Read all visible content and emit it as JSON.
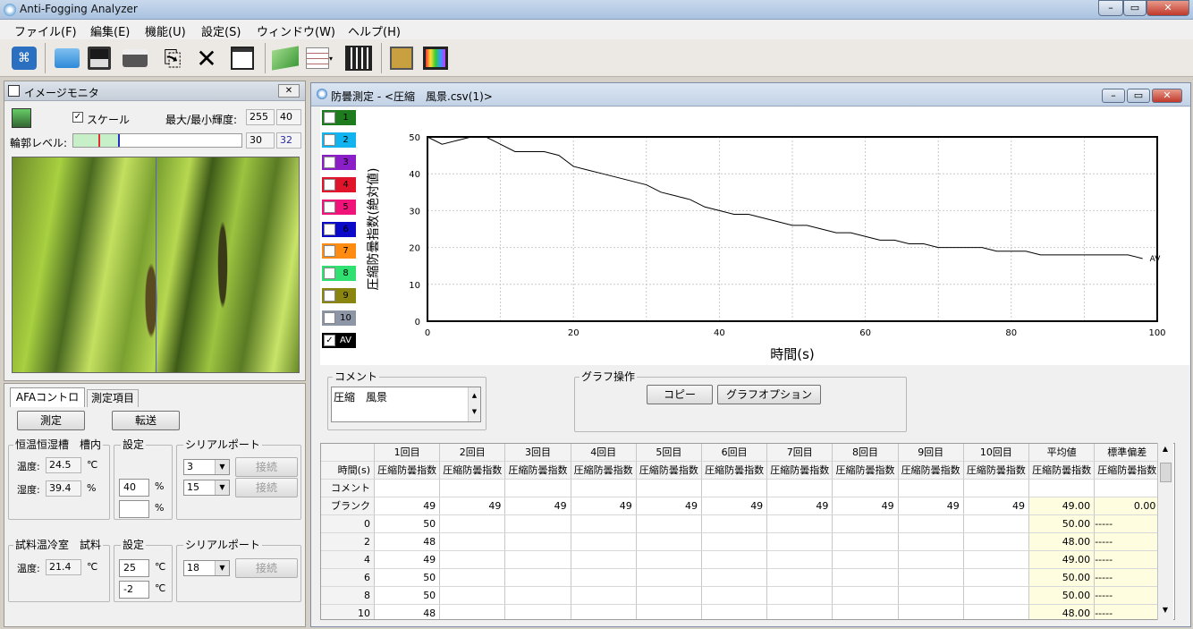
{
  "app": {
    "title": "Anti-Fogging Analyzer"
  },
  "menu": [
    "ファイル(F)",
    "編集(E)",
    "機能(U)",
    "設定(S)",
    "ウィンドウ(W)",
    "ヘルプ(H)"
  ],
  "toolbar": {
    "icons": [
      "monitor-icon",
      "open-folder-icon",
      "save-icon",
      "print-icon",
      "copy-icon",
      "delete-icon",
      "properties-icon",
      "graph-icon",
      "table-icon",
      "export-icon",
      "filter-icon",
      "display-icon"
    ]
  },
  "image_monitor": {
    "title": "イメージモニタ",
    "scale_label": "スケール",
    "scale_checked": true,
    "maxmin_label": "最大/最小輝度:",
    "max_value": "255",
    "min_value": "40",
    "contour_label": "輪郭レベル:",
    "contour_a": "30",
    "contour_b": "32"
  },
  "afa": {
    "tabs": [
      "AFAコントローラ",
      "測定項目"
    ],
    "measure_button": "測定",
    "transfer_button": "転送",
    "chamber": {
      "group_label": "恒温恒湿槽　槽内",
      "temp_label": "温度:",
      "temp_value": "24.5",
      "temp_unit": "℃",
      "hum_label": "湿度:",
      "hum_value": "39.4",
      "hum_unit": "%",
      "setting_label": "設定",
      "set_value1": "40",
      "set_unit1": "%",
      "set_value2": "",
      "set_unit2": "%",
      "serial_label": "シリアルポート",
      "port1": "3",
      "port2": "15",
      "connect1": "接続",
      "connect2": "接続"
    },
    "sample": {
      "group_label": "試料温冷室　試料",
      "temp_label": "温度:",
      "temp_value": "21.4",
      "temp_unit": "℃",
      "setting_label": "設定",
      "set_value1": "25",
      "set_unit1": "℃",
      "set_value2": "-2",
      "set_unit2": "℃",
      "serial_label": "シリアルポート",
      "port": "18",
      "connect": "接続"
    }
  },
  "measurement_window": {
    "title": "防曇測定 - <圧縮　風景.csv(1)>",
    "legend": [
      {
        "label": "1",
        "color": "#1e7b1e",
        "checked": false
      },
      {
        "label": "2",
        "color": "#12b4f0",
        "checked": false
      },
      {
        "label": "3",
        "color": "#8a1fc8",
        "checked": false
      },
      {
        "label": "4",
        "color": "#e0142a",
        "checked": false
      },
      {
        "label": "5",
        "color": "#f0147a",
        "checked": false
      },
      {
        "label": "6",
        "color": "#0a0ac8",
        "checked": false
      },
      {
        "label": "7",
        "color": "#ff8c10",
        "checked": false
      },
      {
        "label": "8",
        "color": "#30e070",
        "checked": false
      },
      {
        "label": "9",
        "color": "#8a8410",
        "checked": false
      },
      {
        "label": "10",
        "color": "#8c96a6",
        "checked": false
      },
      {
        "label": "AV",
        "color": "#000000",
        "checked": true
      }
    ],
    "comment_label": "コメント",
    "comment_text": "圧縮　風景",
    "graph_ops_label": "グラフ操作",
    "copy_button": "コピー",
    "graph_option_button": "グラフオプション"
  },
  "chart_data": {
    "type": "line",
    "xlabel": "時間(s)",
    "ylabel": "圧縮防曇指数(絶対値)",
    "xlim": [
      0,
      100
    ],
    "ylim": [
      0,
      50
    ],
    "xticks": [
      "0",
      "20",
      "40",
      "60",
      "80",
      "100"
    ],
    "yticks": [
      "0",
      "10",
      "20",
      "30",
      "40",
      "50"
    ],
    "grid": true,
    "series": [
      {
        "name": "AV",
        "x": [
          0,
          2,
          4,
          6,
          8,
          10,
          12,
          14,
          16,
          18,
          20,
          22,
          24,
          26,
          28,
          30,
          32,
          34,
          36,
          38,
          40,
          42,
          44,
          46,
          48,
          50,
          52,
          54,
          56,
          58,
          60,
          62,
          64,
          66,
          68,
          70,
          72,
          74,
          76,
          78,
          80,
          82,
          84,
          86,
          88,
          90,
          92,
          94,
          96,
          98
        ],
        "values": [
          50,
          48,
          49,
          50,
          50,
          48,
          46,
          46,
          46,
          45,
          42,
          41,
          40,
          39,
          38,
          37,
          35,
          34,
          33,
          31,
          30,
          29,
          29,
          28,
          27,
          26,
          26,
          25,
          24,
          24,
          23,
          22,
          22,
          21,
          21,
          20,
          20,
          20,
          20,
          19,
          19,
          19,
          18,
          18,
          18,
          18,
          18,
          18,
          18,
          17
        ]
      }
    ]
  },
  "table": {
    "col_headers": [
      "1回目",
      "2回目",
      "3回目",
      "4回目",
      "5回目",
      "6回目",
      "7回目",
      "8回目",
      "9回目",
      "10回目",
      "平均値",
      "標準偏差"
    ],
    "row2_label": "時間(s)",
    "row2_values": [
      "圧縮防曇指数",
      "圧縮防曇指数",
      "圧縮防曇指数",
      "圧縮防曇指数",
      "圧縮防曇指数",
      "圧縮防曇指数",
      "圧縮防曇指数",
      "圧縮防曇指数",
      "圧縮防曇指数",
      "圧縮防曇指数",
      "圧縮防曇指数",
      "圧縮防曇指数"
    ],
    "row3_label": "コメント",
    "blank_label": "ブランク",
    "blank_values": [
      "49",
      "49",
      "49",
      "49",
      "49",
      "49",
      "49",
      "49",
      "49",
      "49",
      "49.00",
      "0.00"
    ],
    "rows": [
      {
        "t": "0",
        "v1": "50",
        "avg": "50.00",
        "sd": "-----"
      },
      {
        "t": "2",
        "v1": "48",
        "avg": "48.00",
        "sd": "-----"
      },
      {
        "t": "4",
        "v1": "49",
        "avg": "49.00",
        "sd": "-----"
      },
      {
        "t": "6",
        "v1": "50",
        "avg": "50.00",
        "sd": "-----"
      },
      {
        "t": "8",
        "v1": "50",
        "avg": "50.00",
        "sd": "-----"
      },
      {
        "t": "10",
        "v1": "48",
        "avg": "48.00",
        "sd": "-----"
      }
    ]
  }
}
